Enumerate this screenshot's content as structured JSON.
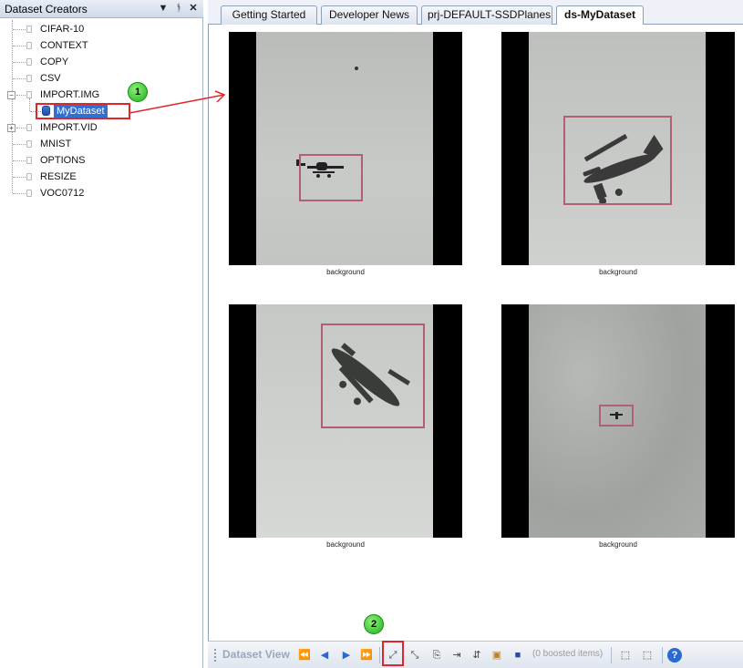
{
  "panel": {
    "title": "Dataset Creators",
    "items": [
      {
        "label": "CIFAR-10"
      },
      {
        "label": "CONTEXT"
      },
      {
        "label": "COPY"
      },
      {
        "label": "CSV"
      },
      {
        "label": "IMPORT.IMG",
        "children": [
          {
            "label": "MyDataset",
            "selected": true
          }
        ]
      },
      {
        "label": "IMPORT.VID"
      },
      {
        "label": "MNIST"
      },
      {
        "label": "OPTIONS"
      },
      {
        "label": "RESIZE"
      },
      {
        "label": "VOC0712"
      }
    ]
  },
  "tabs": [
    {
      "label": "Getting Started"
    },
    {
      "label": "Developer News"
    },
    {
      "label": "prj-DEFAULT-SSDPlanes"
    },
    {
      "label": "ds-MyDataset",
      "active": true
    }
  ],
  "images": [
    {
      "label": "background",
      "subject": "small biplane in flight"
    },
    {
      "label": "background",
      "subject": "biplane in flight, close"
    },
    {
      "label": "background",
      "subject": "biplane banking"
    },
    {
      "label": "background",
      "subject": "distant plane, cloudy sky"
    }
  ],
  "toolbar": {
    "title": "Dataset View",
    "boosted_text": "(0 boosted items)"
  },
  "annotations": {
    "badge1": "1",
    "badge2": "2"
  },
  "colors": {
    "highlight": "#e0262b",
    "badge": "#3fcf3a",
    "selection": "#3070d0",
    "bbox": "#b06070"
  }
}
